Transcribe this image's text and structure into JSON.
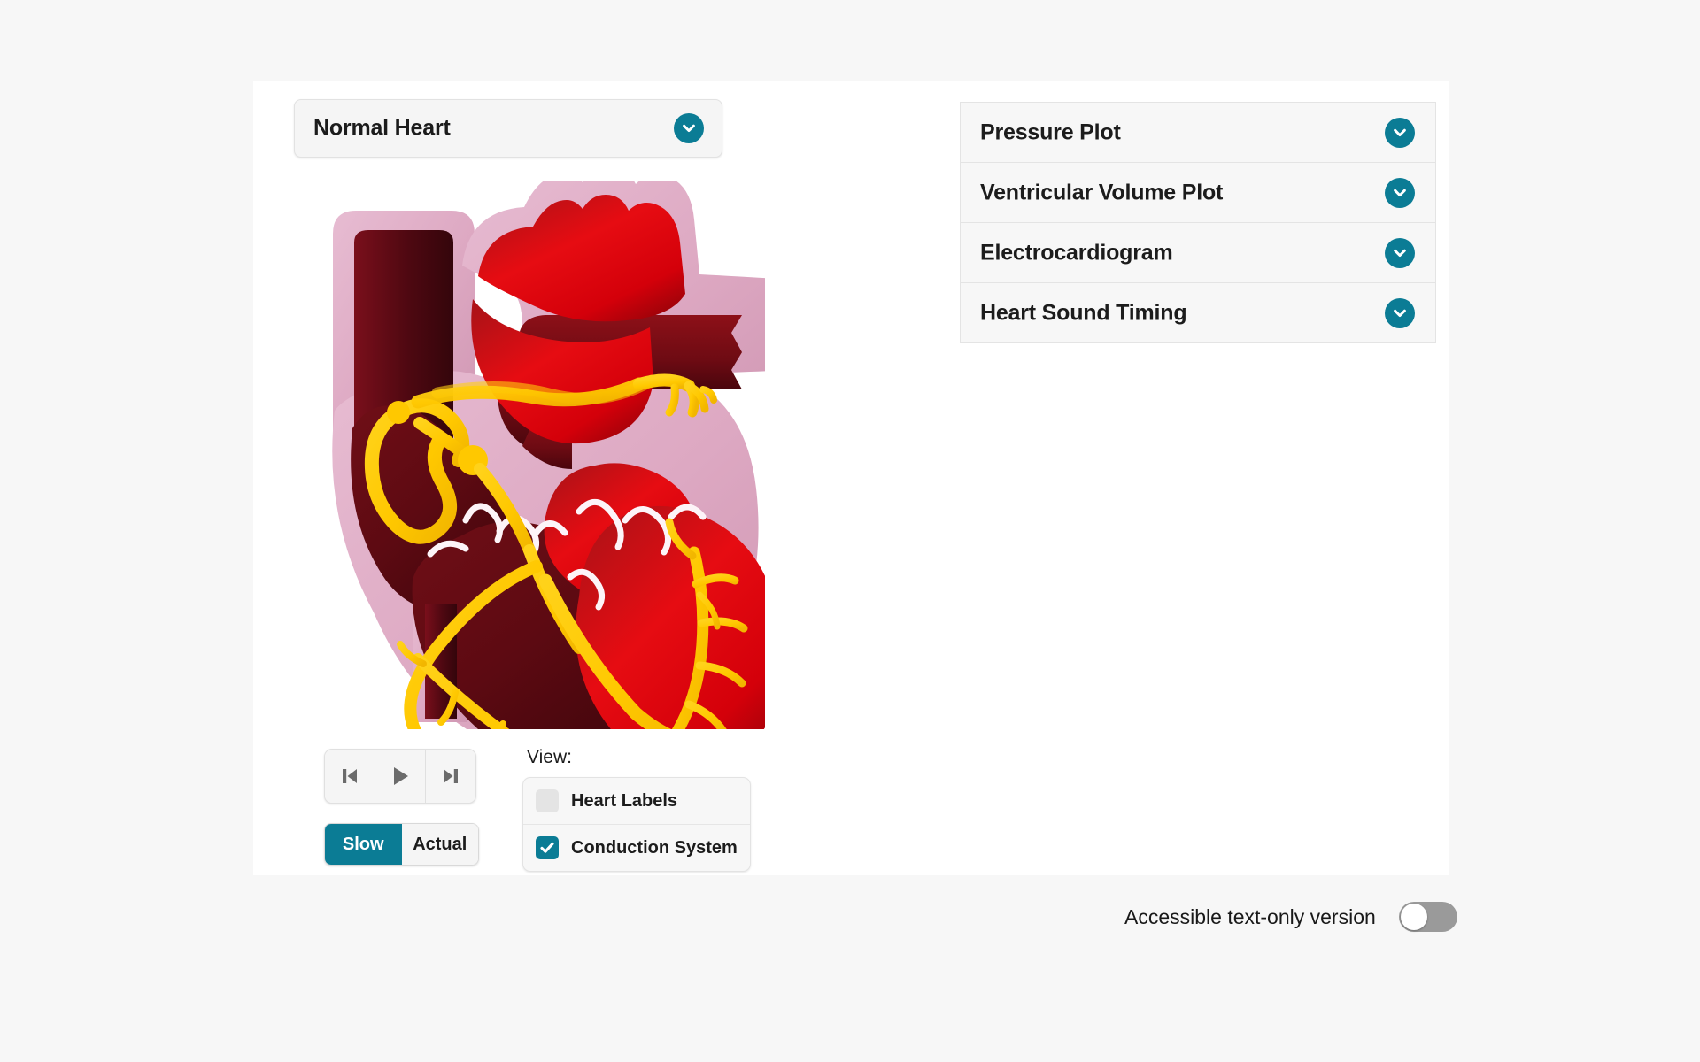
{
  "theme": {
    "accent": "#0b7c95",
    "page_bg": "#f7f7f7",
    "card_bg": "#ffffff",
    "control_bg": "#f5f5f5",
    "text": "#1c1c1c",
    "icon_gray": "#6b6b6b",
    "toggle_off": "#9a9a9a"
  },
  "condition_select": {
    "value": "Normal Heart",
    "chevron_icon": "chevron-down-icon"
  },
  "figure": {
    "name": "heart-anatomy-illustration",
    "alt": "Cross-section of a normal heart with conduction system highlighted"
  },
  "transport": {
    "buttons": [
      {
        "name": "skip-to-start-button",
        "icon": "skip-back-icon",
        "label": "Skip to start"
      },
      {
        "name": "play-button",
        "icon": "play-icon",
        "label": "Play"
      },
      {
        "name": "skip-to-end-button",
        "icon": "skip-forward-icon",
        "label": "Skip to end"
      }
    ]
  },
  "speed_toggle": {
    "selected": "Slow",
    "options": [
      {
        "label": "Slow",
        "selected": true
      },
      {
        "label": "Actual",
        "selected": false
      }
    ]
  },
  "view": {
    "caption": "View:",
    "items": [
      {
        "label": "Heart Labels",
        "checked": false
      },
      {
        "label": "Conduction System",
        "checked": true
      }
    ]
  },
  "accordion": {
    "rows": [
      {
        "title": "Pressure Plot",
        "expanded": false,
        "chevron_icon": "chevron-down-icon"
      },
      {
        "title": "Ventricular Volume Plot",
        "expanded": false,
        "chevron_icon": "chevron-down-icon"
      },
      {
        "title": "Electrocardiogram",
        "expanded": false,
        "chevron_icon": "chevron-down-icon"
      },
      {
        "title": "Heart Sound Timing",
        "expanded": false,
        "chevron_icon": "chevron-down-icon"
      }
    ]
  },
  "accessibility": {
    "label": "Accessible text-only version",
    "enabled": false
  }
}
